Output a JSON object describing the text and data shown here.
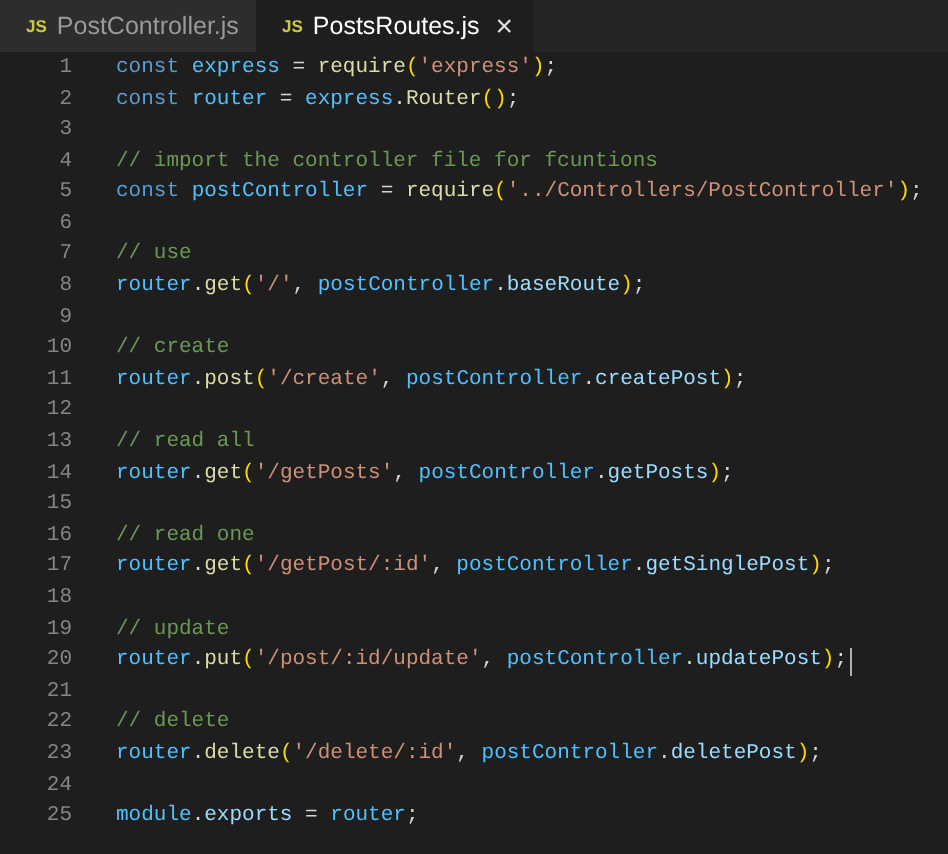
{
  "tabs": [
    {
      "badge": "JS",
      "label": "PostController.js",
      "selected": false
    },
    {
      "badge": "JS",
      "label": "PostsRoutes.js",
      "selected": true,
      "close": "×"
    }
  ],
  "editor": {
    "lines": [
      {
        "number": "1",
        "cursor": false,
        "tokens": [
          {
            "kind": "keyword",
            "text": "const "
          },
          {
            "kind": "variable",
            "text": "express"
          },
          {
            "kind": "punct",
            "text": " = "
          },
          {
            "kind": "function",
            "text": "require"
          },
          {
            "kind": "bracket",
            "text": "("
          },
          {
            "kind": "string",
            "text": "'express'"
          },
          {
            "kind": "bracket",
            "text": ")"
          },
          {
            "kind": "punct",
            "text": ";"
          }
        ]
      },
      {
        "number": "2",
        "cursor": false,
        "tokens": [
          {
            "kind": "keyword",
            "text": "const "
          },
          {
            "kind": "variable",
            "text": "router"
          },
          {
            "kind": "punct",
            "text": " = "
          },
          {
            "kind": "variable",
            "text": "express"
          },
          {
            "kind": "punct",
            "text": "."
          },
          {
            "kind": "function",
            "text": "Router"
          },
          {
            "kind": "bracket",
            "text": "()"
          },
          {
            "kind": "punct",
            "text": ";"
          }
        ]
      },
      {
        "number": "3",
        "cursor": false
      },
      {
        "number": "4",
        "cursor": false,
        "tokens": [
          {
            "kind": "comment",
            "text": "// import the controller file for fcuntions"
          }
        ]
      },
      {
        "number": "5",
        "cursor": false,
        "tokens": [
          {
            "kind": "keyword",
            "text": "const "
          },
          {
            "kind": "variable",
            "text": "postController"
          },
          {
            "kind": "punct",
            "text": " = "
          },
          {
            "kind": "function",
            "text": "require"
          },
          {
            "kind": "bracket",
            "text": "("
          },
          {
            "kind": "string",
            "text": "'../Controllers/PostController'"
          },
          {
            "kind": "bracket",
            "text": ")"
          },
          {
            "kind": "punct",
            "text": ";"
          }
        ]
      },
      {
        "number": "6",
        "cursor": false
      },
      {
        "number": "7",
        "cursor": false,
        "tokens": [
          {
            "kind": "comment",
            "text": "// use"
          }
        ]
      },
      {
        "number": "8",
        "cursor": false,
        "tokens": [
          {
            "kind": "variable",
            "text": "router"
          },
          {
            "kind": "punct",
            "text": "."
          },
          {
            "kind": "function",
            "text": "get"
          },
          {
            "kind": "bracket",
            "text": "("
          },
          {
            "kind": "string",
            "text": "'/'"
          },
          {
            "kind": "punct",
            "text": ", "
          },
          {
            "kind": "variable",
            "text": "postController"
          },
          {
            "kind": "punct",
            "text": "."
          },
          {
            "kind": "property",
            "text": "baseRoute"
          },
          {
            "kind": "bracket",
            "text": ")"
          },
          {
            "kind": "punct",
            "text": ";"
          }
        ]
      },
      {
        "number": "9",
        "cursor": false
      },
      {
        "number": "10",
        "cursor": false,
        "tokens": [
          {
            "kind": "comment",
            "text": "// create"
          }
        ]
      },
      {
        "number": "11",
        "cursor": false,
        "tokens": [
          {
            "kind": "variable",
            "text": "router"
          },
          {
            "kind": "punct",
            "text": "."
          },
          {
            "kind": "function",
            "text": "post"
          },
          {
            "kind": "bracket",
            "text": "("
          },
          {
            "kind": "string",
            "text": "'/create'"
          },
          {
            "kind": "punct",
            "text": ", "
          },
          {
            "kind": "variable",
            "text": "postController"
          },
          {
            "kind": "punct",
            "text": "."
          },
          {
            "kind": "property",
            "text": "createPost"
          },
          {
            "kind": "bracket",
            "text": ")"
          },
          {
            "kind": "punct",
            "text": ";"
          }
        ]
      },
      {
        "number": "12",
        "cursor": false
      },
      {
        "number": "13",
        "cursor": false,
        "tokens": [
          {
            "kind": "comment",
            "text": "// read all"
          }
        ]
      },
      {
        "number": "14",
        "cursor": false,
        "tokens": [
          {
            "kind": "variable",
            "text": "router"
          },
          {
            "kind": "punct",
            "text": "."
          },
          {
            "kind": "function",
            "text": "get"
          },
          {
            "kind": "bracket",
            "text": "("
          },
          {
            "kind": "string",
            "text": "'/getPosts'"
          },
          {
            "kind": "punct",
            "text": ", "
          },
          {
            "kind": "variable",
            "text": "postController"
          },
          {
            "kind": "punct",
            "text": "."
          },
          {
            "kind": "property",
            "text": "getPosts"
          },
          {
            "kind": "bracket",
            "text": ")"
          },
          {
            "kind": "punct",
            "text": ";"
          }
        ]
      },
      {
        "number": "15",
        "cursor": false
      },
      {
        "number": "16",
        "cursor": false,
        "tokens": [
          {
            "kind": "comment",
            "text": "// read one"
          }
        ]
      },
      {
        "number": "17",
        "cursor": false,
        "tokens": [
          {
            "kind": "variable",
            "text": "router"
          },
          {
            "kind": "punct",
            "text": "."
          },
          {
            "kind": "function",
            "text": "get"
          },
          {
            "kind": "bracket",
            "text": "("
          },
          {
            "kind": "string",
            "text": "'/getPost/:id'"
          },
          {
            "kind": "punct",
            "text": ", "
          },
          {
            "kind": "variable",
            "text": "postController"
          },
          {
            "kind": "punct",
            "text": "."
          },
          {
            "kind": "property",
            "text": "getSinglePost"
          },
          {
            "kind": "bracket",
            "text": ")"
          },
          {
            "kind": "punct",
            "text": ";"
          }
        ]
      },
      {
        "number": "18",
        "cursor": false
      },
      {
        "number": "19",
        "cursor": false,
        "tokens": [
          {
            "kind": "comment",
            "text": "// update"
          }
        ]
      },
      {
        "number": "20",
        "cursor": true,
        "tokens": [
          {
            "kind": "variable",
            "text": "router"
          },
          {
            "kind": "punct",
            "text": "."
          },
          {
            "kind": "function",
            "text": "put"
          },
          {
            "kind": "bracket",
            "text": "("
          },
          {
            "kind": "string",
            "text": "'/post/:id/update'"
          },
          {
            "kind": "punct",
            "text": ", "
          },
          {
            "kind": "variable",
            "text": "postController"
          },
          {
            "kind": "punct",
            "text": "."
          },
          {
            "kind": "property",
            "text": "updatePost"
          },
          {
            "kind": "bracket",
            "text": ")"
          },
          {
            "kind": "punct",
            "text": ";"
          }
        ]
      },
      {
        "number": "21",
        "cursor": false
      },
      {
        "number": "22",
        "cursor": false,
        "tokens": [
          {
            "kind": "comment",
            "text": "// delete"
          }
        ]
      },
      {
        "number": "23",
        "cursor": false,
        "tokens": [
          {
            "kind": "variable",
            "text": "router"
          },
          {
            "kind": "punct",
            "text": "."
          },
          {
            "kind": "function",
            "text": "delete"
          },
          {
            "kind": "bracket",
            "text": "("
          },
          {
            "kind": "string",
            "text": "'/delete/:id'"
          },
          {
            "kind": "punct",
            "text": ", "
          },
          {
            "kind": "variable",
            "text": "postController"
          },
          {
            "kind": "punct",
            "text": "."
          },
          {
            "kind": "property",
            "text": "deletePost"
          },
          {
            "kind": "bracket",
            "text": ")"
          },
          {
            "kind": "punct",
            "text": ";"
          }
        ]
      },
      {
        "number": "24",
        "cursor": false
      },
      {
        "number": "25",
        "cursor": false,
        "tokens": [
          {
            "kind": "variable",
            "text": "module"
          },
          {
            "kind": "punct",
            "text": "."
          },
          {
            "kind": "property",
            "text": "exports"
          },
          {
            "kind": "punct",
            "text": " = "
          },
          {
            "kind": "variable",
            "text": "router"
          },
          {
            "kind": "punct",
            "text": ";"
          }
        ]
      }
    ]
  }
}
